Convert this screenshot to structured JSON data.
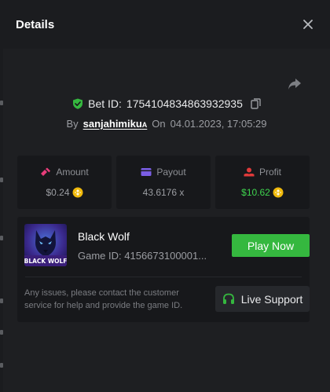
{
  "header": {
    "title": "Details"
  },
  "bet": {
    "label": "Bet ID:",
    "id": "1754104834863932935",
    "by_label": "By",
    "username": "sanjahimiku",
    "username_suffix": "A",
    "on_label": "On",
    "datetime": "04.01.2023, 17:05:29"
  },
  "stats": [
    {
      "label": "Amount",
      "value": "$0.24",
      "icon": "bet-chip-icon",
      "icon_color": "#e83d7a"
    },
    {
      "label": "Payout",
      "value": "43.6176 x",
      "icon": "wallet-icon",
      "icon_color": "#7b5ee6"
    },
    {
      "label": "Profit",
      "value": "$10.62",
      "icon": "profit-icon",
      "icon_color": "#e03a3a"
    }
  ],
  "game": {
    "name": "Black Wolf",
    "game_id_label": "Game ID:",
    "game_id": "4156673100001...",
    "thumb_title": "BLACK WOLF",
    "play_label": "Play Now",
    "issue_text": "Any issues, please contact the customer service for help and provide the game ID.",
    "support_label": "Live Support"
  },
  "colors": {
    "accent_green": "#35b83f",
    "profit_green": "#3fd34e",
    "coin_gold": "#f0b90b"
  }
}
